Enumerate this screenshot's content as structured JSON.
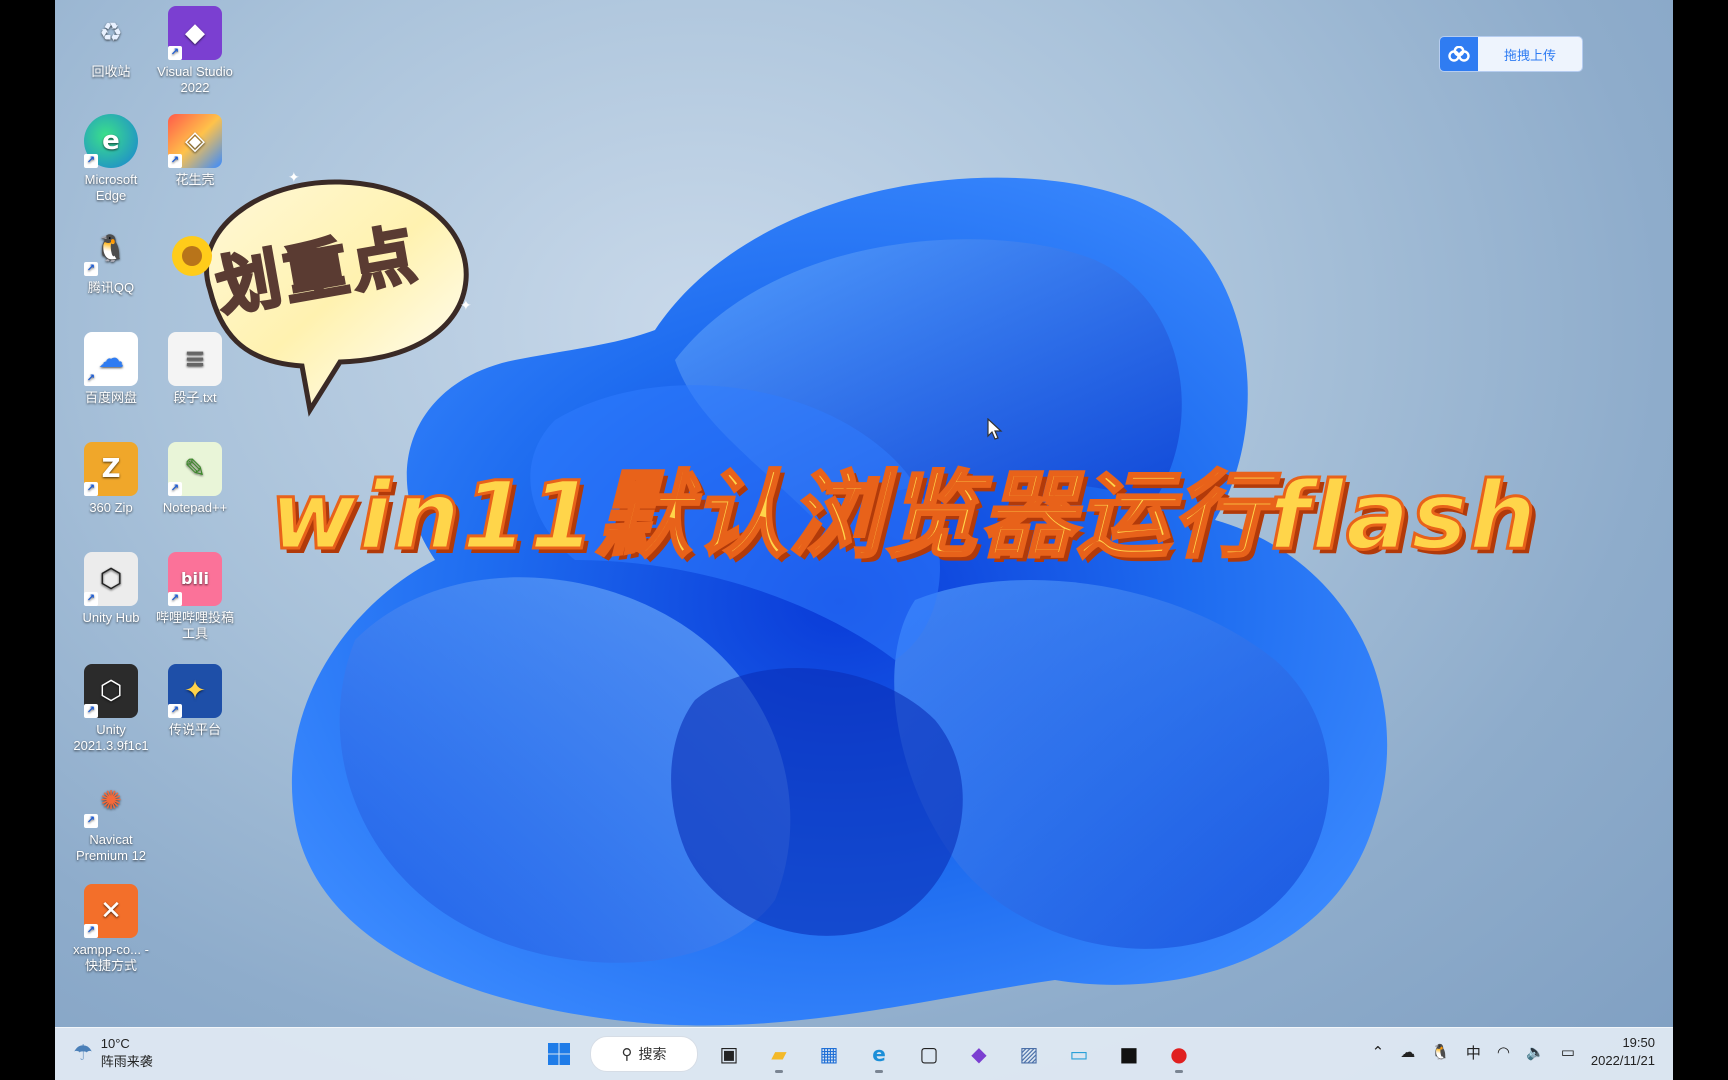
{
  "desktop": {
    "icons": [
      {
        "label": "回收站",
        "glyph": "♻"
      },
      {
        "label": "Visual Studio 2022",
        "glyph": "◆"
      },
      {
        "label": "Microsoft Edge",
        "glyph": "e"
      },
      {
        "label": "花生壳",
        "glyph": "◈"
      },
      {
        "label": "腾讯QQ",
        "glyph": "🐧"
      },
      {
        "label": "百度网盘",
        "glyph": "☁"
      },
      {
        "label": "段子.txt",
        "glyph": "≡"
      },
      {
        "label": "360 Zip",
        "glyph": "Z"
      },
      {
        "label": "Notepad++",
        "glyph": "✎"
      },
      {
        "label": "Unity Hub",
        "glyph": "⬡"
      },
      {
        "label": "哔哩哔哩投稿工具",
        "glyph": "bili"
      },
      {
        "label": "Unity 2021.3.9f1c1",
        "glyph": "⬡"
      },
      {
        "label": "传说平台",
        "glyph": "✦"
      },
      {
        "label": "Navicat Premium 12",
        "glyph": "✺"
      },
      {
        "label": "xampp-co... - 快捷方式",
        "glyph": "✕"
      }
    ]
  },
  "upload_widget": {
    "label": "拖拽上传"
  },
  "overlay": {
    "bubble_text": "划重点",
    "title": "win11默认浏览器运行flash"
  },
  "taskbar": {
    "weather": {
      "temp": "10°C",
      "condition": "阵雨来袭"
    },
    "search_label": "搜索",
    "tray": {
      "ime": "中"
    },
    "clock": {
      "time": "19:50",
      "date": "2022/11/21"
    }
  },
  "colors": {
    "title_fill": "#ffd54a",
    "title_stroke": "#e8621a",
    "accent": "#2f7cf2"
  }
}
